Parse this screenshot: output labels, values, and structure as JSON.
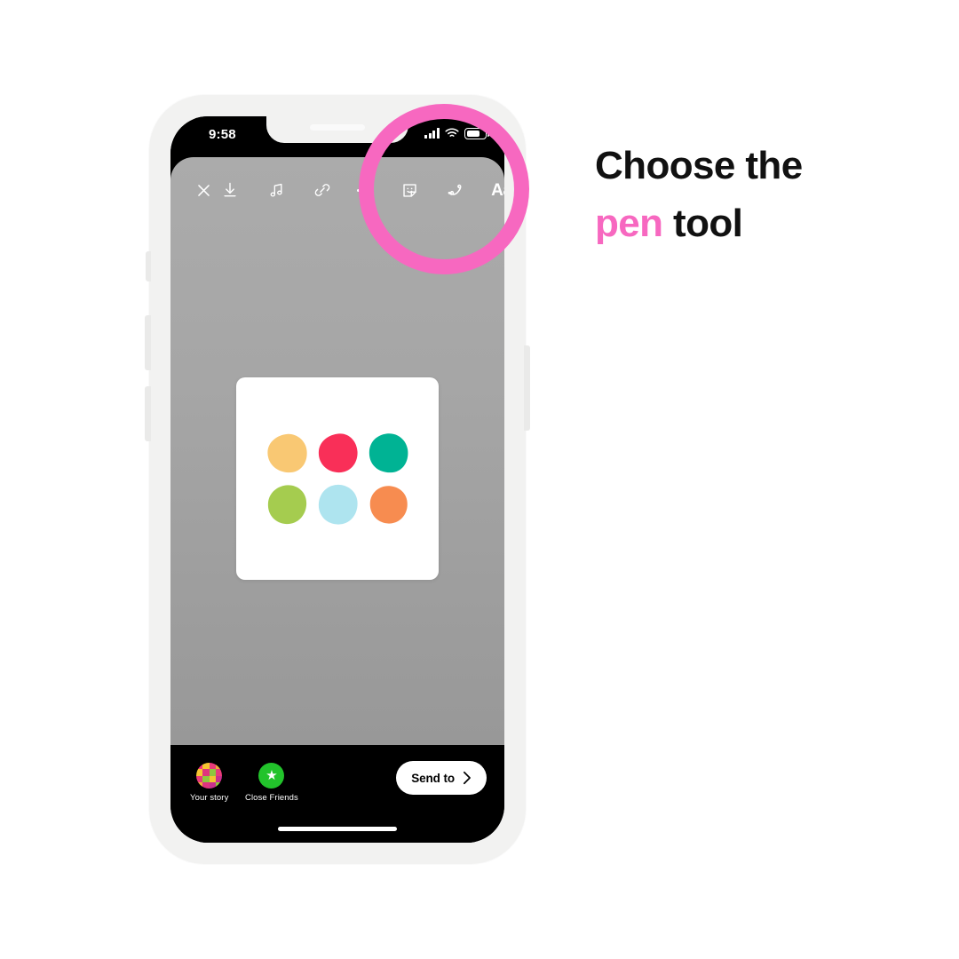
{
  "device": {
    "status_bar": {
      "time": "9:58",
      "signal_icon": "cellular-signal-icon",
      "wifi_icon": "wifi-icon",
      "battery_icon": "battery-icon"
    }
  },
  "story_editor": {
    "toolbar": [
      {
        "name": "close-icon",
        "label": "Close",
        "glyph": "×"
      },
      {
        "name": "download-icon",
        "label": "Save",
        "glyph": "↓"
      },
      {
        "name": "music-icon",
        "label": "Music",
        "glyph": "♫"
      },
      {
        "name": "link-icon",
        "label": "Link",
        "glyph": "🔗"
      },
      {
        "name": "more-icon",
        "label": "More",
        "glyph": "⋯"
      },
      {
        "name": "sticker-icon",
        "label": "Stickers",
        "glyph": "☺"
      },
      {
        "name": "pen-icon",
        "label": "Draw",
        "glyph": "✎"
      },
      {
        "name": "text-icon",
        "label": "Text",
        "glyph": "Aa"
      }
    ],
    "text_tool_label": "Aa",
    "canvas": {
      "background_gradient_from": "#ababab",
      "background_gradient_to": "#989898",
      "media_card": {
        "background": "#ffffff",
        "blobs": [
          {
            "name": "blob-yellow",
            "color": "#f9c873"
          },
          {
            "name": "blob-pink-red",
            "color": "#f92f58"
          },
          {
            "name": "blob-teal",
            "color": "#00b394"
          },
          {
            "name": "blob-green",
            "color": "#a5cc4f"
          },
          {
            "name": "blob-light-blue",
            "color": "#aee4ef"
          },
          {
            "name": "blob-orange",
            "color": "#f78c50"
          }
        ]
      }
    },
    "bottom_bar": {
      "destinations": [
        {
          "name": "your-story",
          "label": "Your story",
          "icon": "story-grid-avatar"
        },
        {
          "name": "close-friends",
          "label": "Close Friends",
          "icon": "green-star-icon",
          "color": "#22c32b"
        }
      ],
      "send_button": {
        "label": "Send to",
        "chevron": "chevron-right-icon"
      }
    }
  },
  "annotation": {
    "highlight_color": "#f768c0",
    "highlight_target": "pen-tool"
  },
  "caption": {
    "line1": "Choose the",
    "accent_word": "pen",
    "line2_suffix": " tool",
    "accent_color": "#f768c0"
  }
}
